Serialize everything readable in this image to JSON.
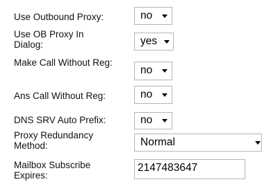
{
  "settings": [
    {
      "label": "Use Outbound Proxy:",
      "value": "no"
    },
    {
      "label": "Use OB Proxy In Dialog:",
      "value": "yes"
    },
    {
      "label": "Make Call Without Reg:",
      "value": "no"
    },
    {
      "label": "Ans Call Without Reg:",
      "value": "no"
    },
    {
      "label": "DNS SRV Auto Prefix:",
      "value": "no"
    },
    {
      "label": "Proxy Redundancy Method:",
      "value": "Normal"
    },
    {
      "label": "Mailbox Subscribe Expires:",
      "value": "2147483647"
    }
  ],
  "icons": {
    "dropdown": "chevron-down-icon"
  }
}
